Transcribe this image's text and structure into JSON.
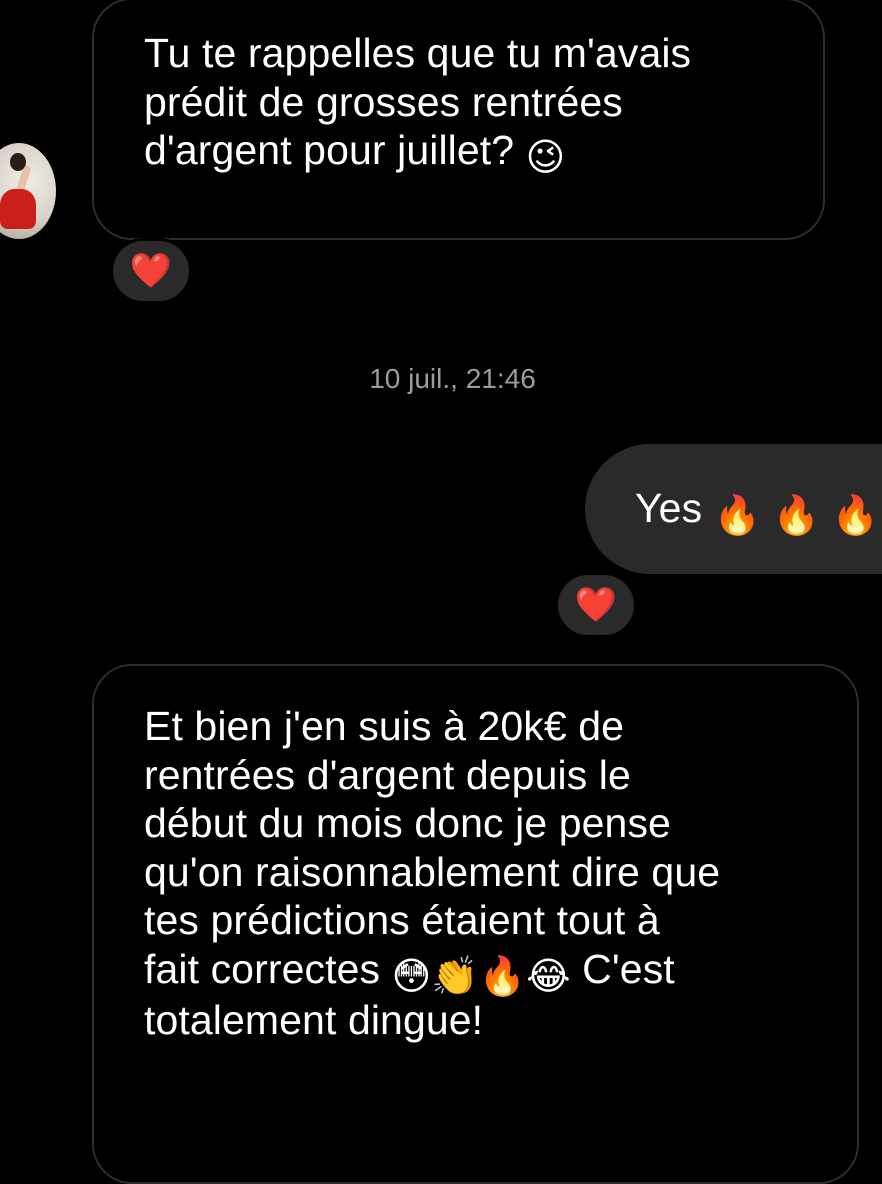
{
  "conversation": {
    "messages": [
      {
        "direction": "incoming",
        "lines": [
          "Tu te rappelles que tu m'avais",
          "prédit de grosses rentrées",
          "d'argent pour juillet?"
        ],
        "emoji": "😉",
        "reaction": "❤️"
      },
      {
        "direction": "outgoing",
        "text": "Yes",
        "emojis": [
          "🔥",
          "🔥",
          "🔥"
        ],
        "reaction": "❤️"
      },
      {
        "direction": "incoming",
        "lines": [
          "Et bien j'en suis à 20k€ de",
          "rentrées d'argent depuis le",
          "début du mois donc je pense",
          "qu'on raisonnablement dire que",
          "tes prédictions étaient tout à",
          "fait correctes",
          "C'est",
          "totalement dingue!"
        ],
        "emojis": [
          "😳",
          "👏",
          "🔥",
          "😂"
        ]
      }
    ],
    "timestamp": "10 juil., 21:46"
  },
  "colors": {
    "background": "#000000",
    "incoming_border": "#2e2e2e",
    "outgoing_bubble": "#2a2a2a",
    "timestamp_text": "#9c9c9c",
    "heart": "#e0191f"
  },
  "icons": {
    "avatar": "contact-avatar",
    "reaction": "heart-icon"
  }
}
